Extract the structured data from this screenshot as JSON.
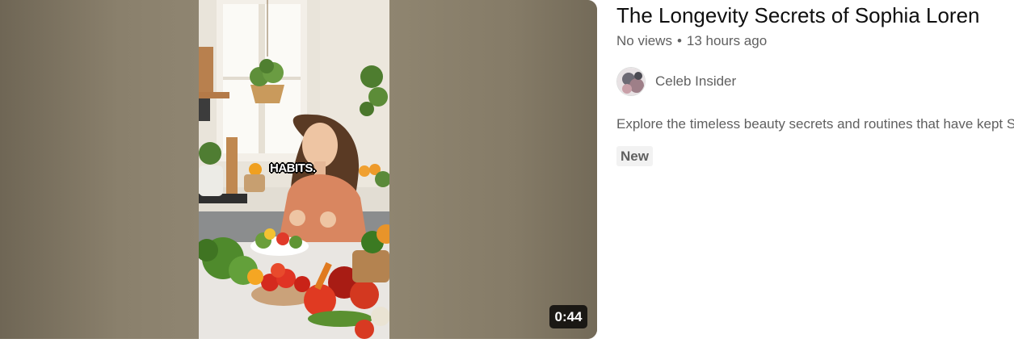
{
  "video": {
    "title": "The Longevity Secrets of Sophia Loren",
    "views": "No views",
    "separator": "•",
    "age": "13 hours ago",
    "duration": "0:44",
    "caption": "HABITS.",
    "channel": "Celeb Insider",
    "description": "Explore the timeless beauty secrets and routines that have kept Sophia Loren",
    "badge": "New"
  },
  "colors": {
    "title": "#0f0f0f",
    "secondary_text": "#606060",
    "badge_bg": "#f2f2f2",
    "duration_bg": "#000000"
  }
}
